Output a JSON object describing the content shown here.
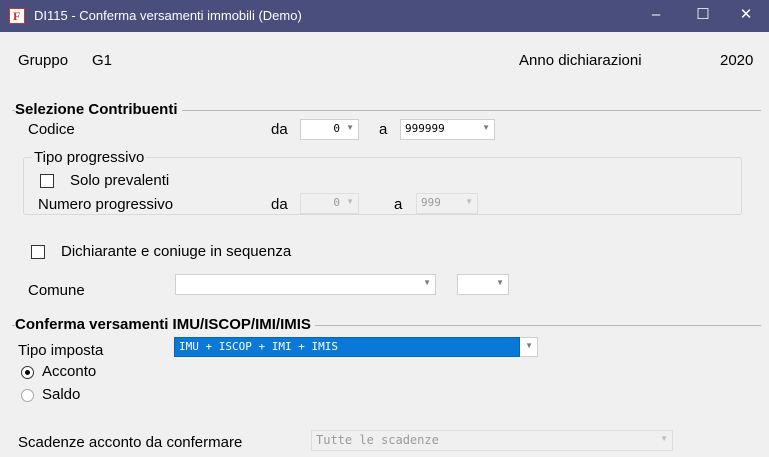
{
  "window": {
    "title": "DI115 - Conferma versamenti immobili (Demo)",
    "app_icon_letter": "F",
    "minimize": "–",
    "maximize": "☐",
    "close": "✕"
  },
  "header": {
    "gruppo_label": "Gruppo",
    "gruppo_value": "G1",
    "anno_label": "Anno dichiarazioni",
    "anno_value": "2020"
  },
  "selezione": {
    "title": "Selezione Contribuenti",
    "codice_label": "Codice",
    "da_label": "da",
    "codice_da": "0",
    "a_label": "a",
    "codice_a": "999999",
    "tipo_progressivo_title": "Tipo progressivo",
    "solo_prevalenti_label": "Solo prevalenti",
    "solo_prevalenti_checked": false,
    "numero_progressivo_label": "Numero progressivo",
    "np_da_label": "da",
    "np_da": "0",
    "np_a_label": "a",
    "np_a": "999",
    "dichiarante_label": "Dichiarante e coniuge in sequenza",
    "dichiarante_checked": false,
    "comune_label": "Comune",
    "comune_value": "",
    "comune2_value": ""
  },
  "conferma": {
    "title": "Conferma versamenti IMU/ISCOP/IMI/IMIS",
    "tipo_imposta_label": "Tipo imposta",
    "tipo_imposta_value": "IMU + ISCOP + IMI + IMIS",
    "acconto_label": "Acconto",
    "saldo_label": "Saldo",
    "selected_option": "Acconto",
    "scadenze_label": "Scadenze acconto da confermare",
    "scadenze_value": "Tutte le scadenze"
  }
}
